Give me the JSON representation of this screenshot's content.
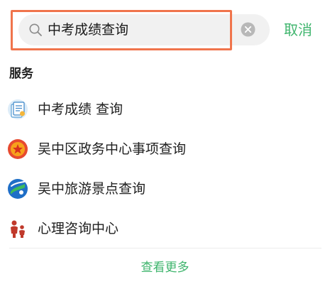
{
  "search": {
    "query": "中考成绩查询",
    "cancel_label": "取消",
    "highlight_color": "#f0744c",
    "accent_color": "#3fb56d"
  },
  "section": {
    "title": "服务"
  },
  "services": [
    {
      "label": "中考成绩 查询",
      "icon": "certificate-icon"
    },
    {
      "label": "吴中区政务中心事项查询",
      "icon": "government-emblem-icon"
    },
    {
      "label": "吴中旅游景点查询",
      "icon": "tourism-logo-icon"
    },
    {
      "label": "心理咨询中心",
      "icon": "family-icon"
    }
  ],
  "more_label": "查看更多"
}
